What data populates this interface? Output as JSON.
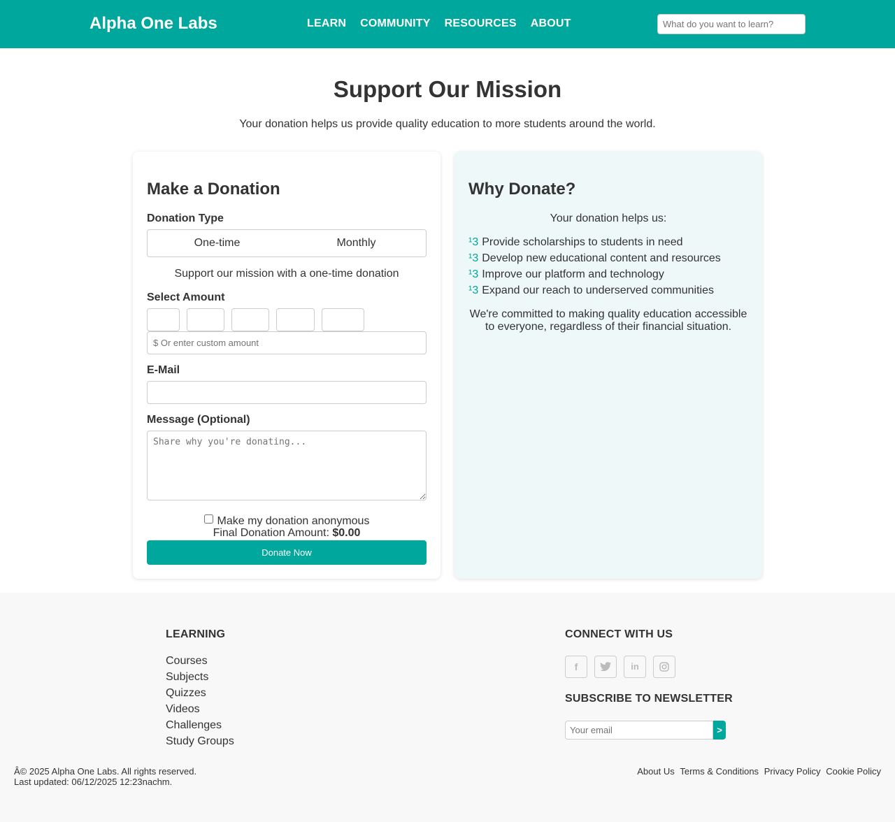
{
  "brand": "Alpha One Labs",
  "nav": {
    "items": [
      "LEARN",
      "COMMUNITY",
      "RESOURCES",
      "ABOUT"
    ]
  },
  "search": {
    "placeholder": "What do you want to learn?"
  },
  "hero": {
    "title": "Support Our Mission",
    "subtitle": "Your donation helps us provide quality education to more students around the world."
  },
  "donation": {
    "heading": "Make a Donation",
    "type_label": "Donation Type",
    "types": [
      "One-time",
      "Monthly"
    ],
    "type_note": "Support our mission with a one-time donation",
    "amount_label": "Select Amount",
    "amount_options": [
      "",
      "",
      "",
      "",
      ""
    ],
    "custom_placeholder": "$ Or enter custom amount",
    "email_label": "E-Mail",
    "email_value": "",
    "message_label": "Message (Optional)",
    "message_placeholder": "Share why you're donating...",
    "anonymous_label": "Make my donation anonymous",
    "anonymous_checked": false,
    "final_label": "Final Donation Amount:",
    "final_amount": "$0.00",
    "submit_label": "Donate Now"
  },
  "why": {
    "heading": "Why Donate?",
    "intro": "Your donation helps us:",
    "bullet_glyph": "¹3",
    "items": [
      "Provide scholarships to students in need",
      "Develop new educational content and resources",
      "Improve our platform and technology",
      "Expand our reach to underserved communities"
    ],
    "commitment": "We're committed to making quality education accessible to everyone, regardless of their financial situation."
  },
  "footer": {
    "learning_heading": "LEARNING",
    "learning_links": [
      "Courses",
      "Subjects",
      "Quizzes",
      "Videos",
      "Challenges",
      "Study Groups"
    ],
    "connect_heading": "CONNECT WITH US",
    "social_icons": [
      "facebook-icon",
      "twitter-icon",
      "linkedin-icon",
      "instagram-icon"
    ],
    "newsletter_heading": "SUBSCRIBE TO NEWSLETTER",
    "newsletter_placeholder": "Your email",
    "newsletter_button": ">",
    "copyright": "Â© 2025 Alpha One Labs. All rights reserved.",
    "last_updated": "Last updated: 06/12/2025 12:23nachm.",
    "legal_links": [
      "About Us",
      "Terms & Conditions",
      "Privacy Policy",
      "Cookie Policy"
    ]
  },
  "colors": {
    "accent": "#00a79d",
    "panel": "#eef8f8",
    "footer_bg": "#f8f8f8"
  }
}
